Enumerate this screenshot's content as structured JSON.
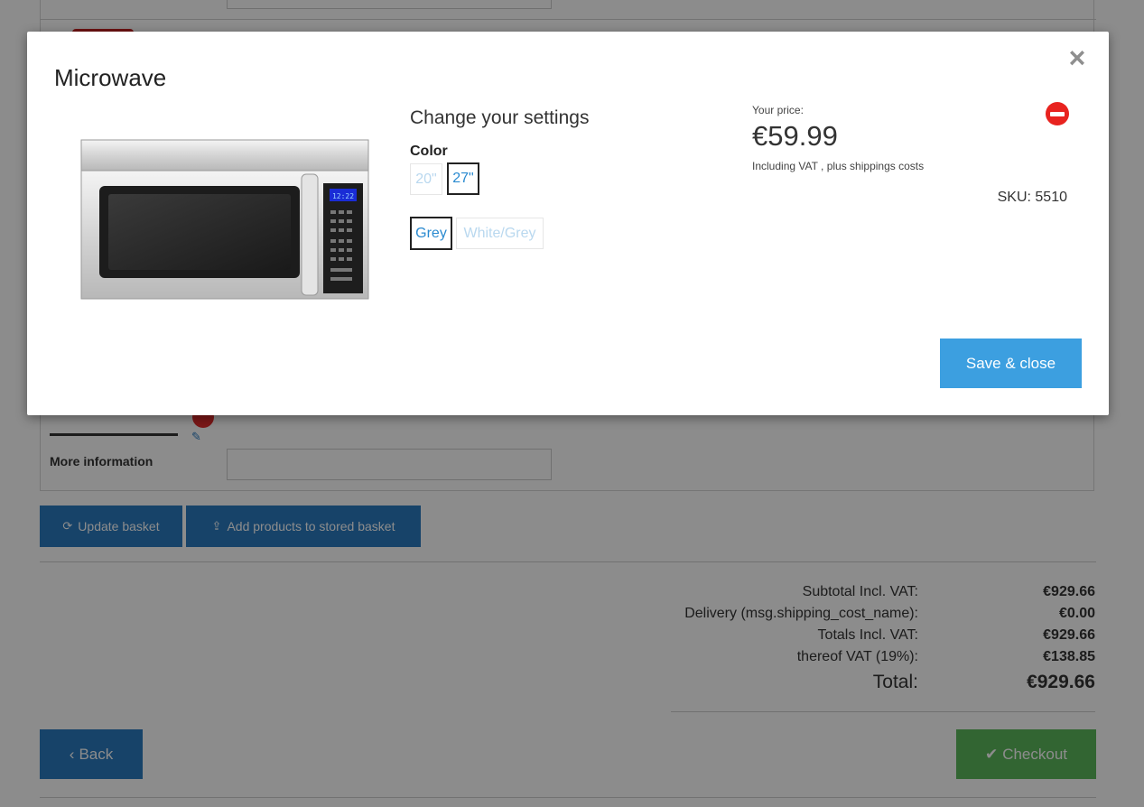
{
  "background": {
    "more_information_label": "More information",
    "update_basket": "Update basket",
    "add_products_stored": "Add products to stored basket",
    "totals": [
      {
        "label": "Subtotal Incl. VAT:",
        "value": "€929.66"
      },
      {
        "label": "Delivery (msg.shipping_cost_name):",
        "value": "€0.00"
      },
      {
        "label": "Totals Incl. VAT:",
        "value": "€929.66"
      },
      {
        "label": "thereof VAT (19%):",
        "value": "€138.85"
      }
    ],
    "grand_total": {
      "label": "Total:",
      "value": "€929.66"
    },
    "back_label": "Back",
    "checkout_label": "Checkout"
  },
  "modal": {
    "title": "Microwave",
    "close_symbol": "×",
    "settings_title": "Change your settings",
    "color_label": "Color",
    "size_options": [
      {
        "label": "20\"",
        "state": "disabled"
      },
      {
        "label": "27\"",
        "state": "selected"
      }
    ],
    "color_options": [
      {
        "label": "Grey",
        "state": "selected"
      },
      {
        "label": "White/Grey",
        "state": "disabled"
      }
    ],
    "price_label": "Your price:",
    "price": "€59.99",
    "vat_note": "Including VAT , plus shippings costs",
    "sku": "SKU: 5510",
    "save_close": "Save & close",
    "microwave_display": "12:22"
  },
  "colors": {
    "accent_blue": "#2a7ac0",
    "save_blue": "#3c9fe0",
    "checkout_green": "#5cb85c",
    "remove_red": "#e8231f",
    "option_link": "#2a8ad0"
  }
}
